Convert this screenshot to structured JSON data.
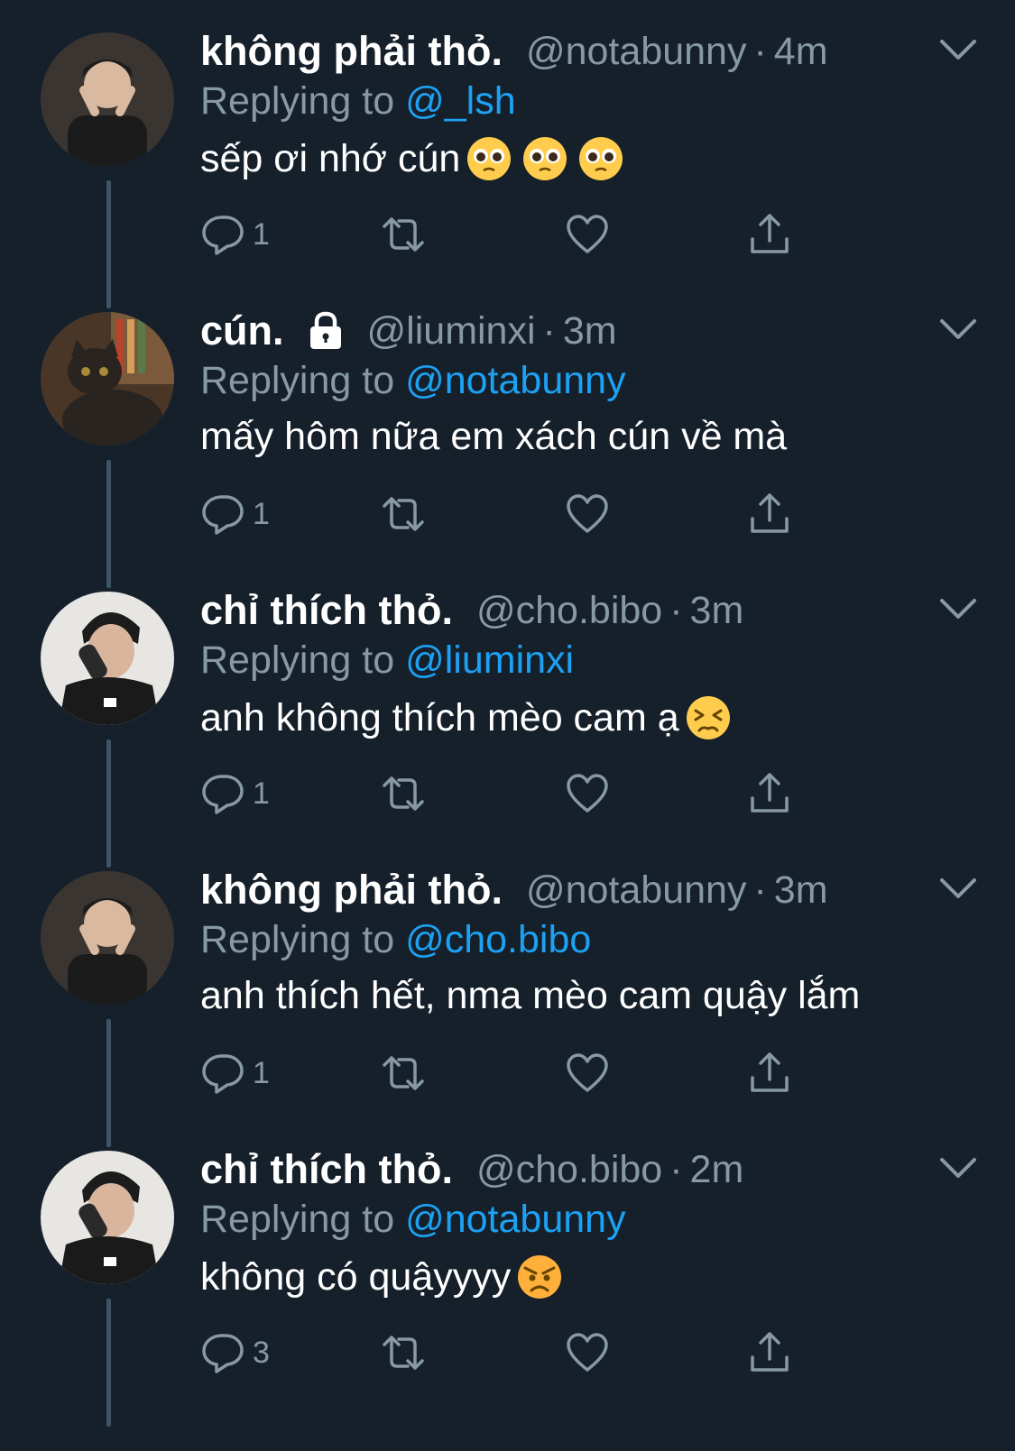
{
  "tweets": [
    {
      "name": "không phải thỏ.",
      "handle": "@notabunny",
      "dot": "·",
      "time": "4m",
      "replying_prefix": "Replying to ",
      "replying_to": "@_lsh",
      "text": "sếp ơi nhớ cún",
      "emojis": [
        "pleading-face",
        "pleading-face",
        "pleading-face"
      ],
      "reply_count": "1",
      "locked": false
    },
    {
      "name": "cún.",
      "handle": "@liuminxi",
      "dot": "·",
      "time": "3m",
      "replying_prefix": "Replying to ",
      "replying_to": "@notabunny",
      "text": "mấy hôm nữa em xách cún về mà",
      "emojis": [],
      "reply_count": "1",
      "locked": true
    },
    {
      "name": "chỉ thích thỏ.",
      "handle": "@cho.bibo",
      "dot": "·",
      "time": "3m",
      "replying_prefix": "Replying to ",
      "replying_to": "@liuminxi",
      "text": "anh không thích mèo cam ạ",
      "emojis": [
        "persevering-face"
      ],
      "reply_count": "1",
      "locked": false
    },
    {
      "name": "không phải thỏ.",
      "handle": "@notabunny",
      "dot": "·",
      "time": "3m",
      "replying_prefix": "Replying to ",
      "replying_to": "@cho.bibo",
      "text": "anh thích hết, nma mèo cam quậy lắm",
      "emojis": [],
      "reply_count": "1",
      "locked": false
    },
    {
      "name": "chỉ thích thỏ.",
      "handle": "@cho.bibo",
      "dot": "·",
      "time": "2m",
      "replying_prefix": "Replying to ",
      "replying_to": "@notabunny",
      "text": "không có quậyyyy",
      "emojis": [
        "angry-face"
      ],
      "reply_count": "3",
      "locked": false
    }
  ],
  "colors": {
    "background": "#15202b",
    "secondary_text": "#8899a6",
    "link": "#1da1f2",
    "thread_line": "#3d5466"
  }
}
